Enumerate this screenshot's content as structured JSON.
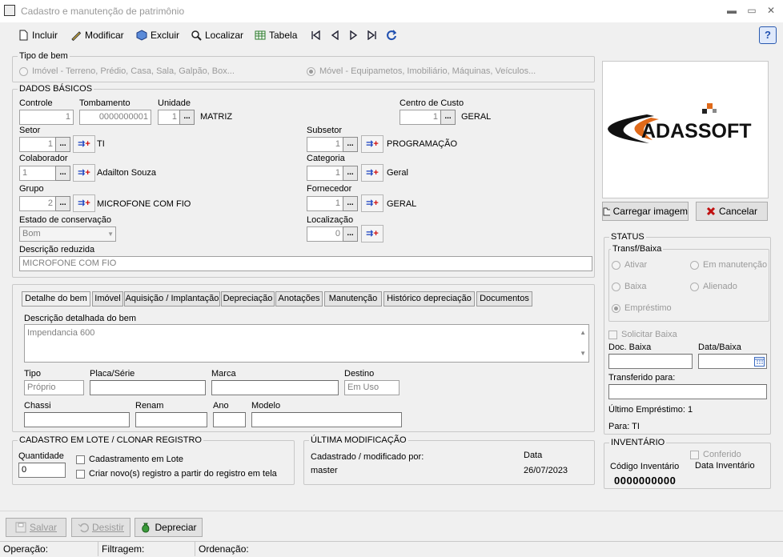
{
  "window": {
    "title": "Cadastro e manutenção de patrimônio",
    "min": "▬",
    "max": "▭",
    "close": "✕"
  },
  "toolbar": {
    "incluir": "Incluir",
    "modificar": "Modificar",
    "excluir": "Excluir",
    "localizar": "Localizar",
    "tabela": "Tabela",
    "help": "?"
  },
  "tipo_bem": {
    "legend": "Tipo de bem",
    "imovel": "Imóvel - Terreno, Prédio, Casa, Sala, Galpão, Box...",
    "movel": "Móvel - Equipametos, Imobiliário, Máquinas, Veículos...",
    "selected": "movel"
  },
  "dados": {
    "legend": "DADOS BÁSICOS",
    "controle_label": "Controle",
    "controle_value": "1",
    "tombamento_label": "Tombamento",
    "tombamento_value": "0000000001",
    "unidade_label": "Unidade",
    "unidade_value": "1",
    "unidade_name": "MATRIZ",
    "centro_label": "Centro de Custo",
    "centro_value": "1",
    "centro_name": "GERAL",
    "setor_label": "Setor",
    "setor_value": "1",
    "setor_name": "TI",
    "subsetor_label": "Subsetor",
    "subsetor_value": "1",
    "subsetor_name": "PROGRAMAÇÃO",
    "colaborador_label": "Colaborador",
    "colaborador_value": "1",
    "colaborador_name": "Adailton Souza",
    "categoria_label": "Categoria",
    "categoria_value": "1",
    "categoria_name": "Geral",
    "grupo_label": "Grupo",
    "grupo_value": "2",
    "grupo_name": "MICROFONE COM FIO",
    "fornecedor_label": "Fornecedor",
    "fornecedor_value": "1",
    "fornecedor_name": "GERAL",
    "estado_label": "Estado de conservação",
    "estado_value": "Bom",
    "localizacao_label": "Localização",
    "localizacao_value": "0",
    "descricao_label": "Descrição reduzida",
    "descricao_value": "MICROFONE COM FIO",
    "dots": "..."
  },
  "tabs": [
    "Detalhe do bem",
    "Imóvel",
    "Aquisição / Implantação",
    "Depreciação",
    "Anotações",
    "Manutenção",
    "Histórico depreciação",
    "Documentos"
  ],
  "detalhe": {
    "desc_label": "Descrição detalhada do bem",
    "desc_value": "Impendancia 600",
    "tipo_label": "Tipo",
    "tipo_value": "Próprio",
    "placa_label": "Placa/Série",
    "placa_value": "",
    "marca_label": "Marca",
    "marca_value": "",
    "destino_label": "Destino",
    "destino_value": "Em Uso",
    "chassi_label": "Chassi",
    "renam_label": "Renam",
    "ano_label": "Ano",
    "modelo_label": "Modelo"
  },
  "logo": {
    "text": "ADASSOFT"
  },
  "image_buttons": {
    "carregar": "Carregar imagem",
    "cancelar": "Cancelar"
  },
  "status": {
    "legend": "STATUS",
    "transf_legend": "Transf/Baixa",
    "ativar": "Ativar",
    "manutencao": "Em manutenção",
    "baixa": "Baixa",
    "alienado": "Alienado",
    "emprestimo": "Empréstimo",
    "selected": "emprestimo",
    "solicitar": "Solicitar Baixa",
    "doc_baixa": "Doc. Baixa",
    "data_baixa": "Data/Baixa",
    "transferido": "Transferido para:",
    "ultimo": "Último Empréstimo: 1",
    "para": "Para: TI"
  },
  "lote": {
    "legend": "CADASTRO EM LOTE / CLONAR REGISTRO",
    "quantidade_label": "Quantidade",
    "quantidade_value": "0",
    "lote_cb": "Cadastramento em Lote",
    "clonar_cb": "Criar novo(s) registro a partir do registro em tela"
  },
  "ultima": {
    "legend": "ÚLTIMA MODIFICAÇÃO",
    "cadastrado_label": "Cadastrado / modificado por:",
    "user": "master",
    "data_label": "Data",
    "data_value": "26/07/2023"
  },
  "inventario": {
    "legend": "INVENTÁRIO",
    "conferido": "Conferido",
    "codigo_label": "Código Inventário",
    "data_label": "Data Inventário",
    "codigo_value": "0000000000"
  },
  "bottom": {
    "salvar": "Salvar",
    "desistir": "Desistir",
    "depreciar": "Depreciar"
  },
  "statusbar": {
    "operacao": "Operação:",
    "filtragem": "Filtragem:",
    "ordenacao": "Ordenação:"
  }
}
